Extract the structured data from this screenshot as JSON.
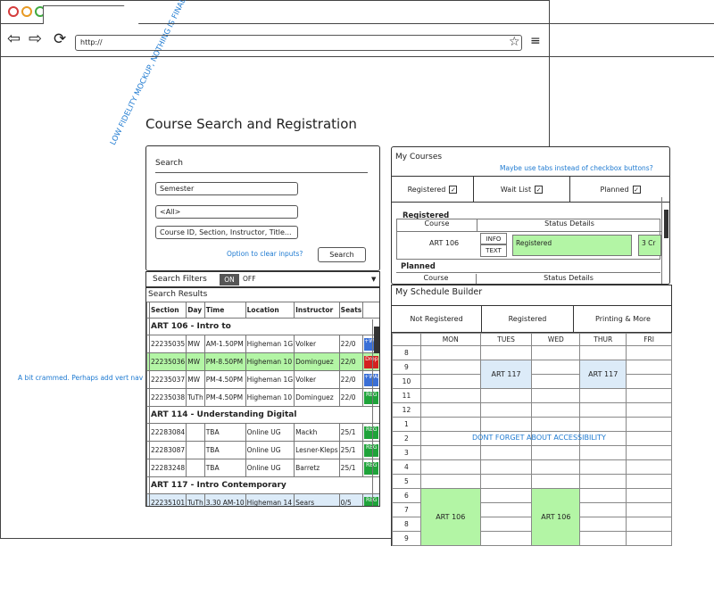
{
  "annotations": {
    "low_fidelity": "LOW FIDELITY MOCKUP, NOTHING IS FINAL!",
    "crammed": "A bit crammed. Perhaps add vert nav",
    "tabs": "Maybe use tabs instead of checkbox buttons?",
    "clear_inputs": "Option to clear inputs?",
    "accessibility": "DONT FORGET ABOUT ACCESSIBILITY"
  },
  "browser": {
    "url": "http://",
    "star_icon": "star-icon",
    "menu_icon": "hamburger-icon"
  },
  "page": {
    "title": "Course Search and Registration"
  },
  "search": {
    "title": "Search",
    "semester": "Semester",
    "all": "<All>",
    "query_placeholder": "Course ID, Section, Instructor, Title...",
    "button": "Search",
    "filters_label": "Search Filters",
    "filters_on": "ON",
    "filters_off": "OFF"
  },
  "results": {
    "title": "Search Results",
    "columns": [
      "Section",
      "Day",
      "Time",
      "Location",
      "Instructor",
      "Seats"
    ],
    "groups": [
      {
        "title": "ART 106 - Intro to",
        "rows": [
          {
            "section": "22235035",
            "day": "MW",
            "time": "AM-1.50PM",
            "location": "Higheman 1G",
            "instructor": "Volker",
            "seats": "22/0",
            "chip": "+WAIT",
            "chip_color": "#3a6fd6",
            "hl": ""
          },
          {
            "section": "22235036",
            "day": "MW",
            "time": "PM-8.50PM",
            "location": "Higheman 10",
            "instructor": "Dominguez",
            "seats": "22/0",
            "chip": "Drop",
            "chip_color": "#d42020",
            "hl": "green"
          },
          {
            "section": "22235037",
            "day": "MW",
            "time": "PM-4.50PM",
            "location": "Higheman 1G",
            "instructor": "Volker",
            "seats": "22/0",
            "chip": "+WAIT",
            "chip_color": "#3a6fd6",
            "hl": ""
          },
          {
            "section": "22235038",
            "day": "TuTh",
            "time": "PM-4.50PM",
            "location": "Higheman 10",
            "instructor": "Dominguez",
            "seats": "22/0",
            "chip": "REG",
            "chip_color": "#1fa33a",
            "hl": ""
          }
        ]
      },
      {
        "title": "ART 114 - Understanding Digital",
        "rows": [
          {
            "section": "22283084",
            "day": "",
            "time": "TBA",
            "location": "Online UG",
            "instructor": "Mackh",
            "seats": "25/1",
            "chip": "REG",
            "chip_color": "#1fa33a",
            "hl": ""
          },
          {
            "section": "22283087",
            "day": "",
            "time": "TBA",
            "location": "Online UG",
            "instructor": "Lesner-Kleps",
            "seats": "25/1",
            "chip": "REG",
            "chip_color": "#1fa33a",
            "hl": ""
          },
          {
            "section": "22283248",
            "day": "",
            "time": "TBA",
            "location": "Online UG",
            "instructor": "Barretz",
            "seats": "25/1",
            "chip": "REG",
            "chip_color": "#1fa33a",
            "hl": ""
          }
        ]
      },
      {
        "title": "ART 117 - Intro Contemporary",
        "rows": [
          {
            "section": "22235101",
            "day": "TuTh",
            "time": "3.30 AM-10",
            "location": "Higheman 14",
            "instructor": "Sears",
            "seats": "0/5",
            "chip": "REG",
            "chip_color": "#1fa33a",
            "hl": "blue"
          }
        ]
      }
    ]
  },
  "my_courses": {
    "title": "My Courses",
    "tabs": [
      {
        "label": "Registered",
        "checked": "✓"
      },
      {
        "label": "Wait List",
        "checked": "✓"
      },
      {
        "label": "Planned",
        "checked": "✓"
      }
    ],
    "registered_header": "Registered",
    "planned_header": "Planned",
    "col_course": "Course",
    "col_status": "Status Details",
    "registered_row": {
      "course": "ART 106",
      "info": "INFO",
      "text": "TEXT",
      "status": "Registered",
      "credits": "3 Cr"
    }
  },
  "schedule": {
    "title": "My Schedule Builder",
    "tabs": [
      "Not Registered",
      "Registered",
      "Printing & More"
    ],
    "days": [
      "MON",
      "TUES",
      "WED",
      "THUR",
      "FRI"
    ],
    "hours": [
      "8",
      "9",
      "10",
      "11",
      "12",
      "1",
      "2",
      "3",
      "4",
      "5",
      "6",
      "7",
      "8",
      "9"
    ],
    "blocks": {
      "tues_9": "ART 117",
      "thur_9": "ART 117",
      "mon_7": "ART 106",
      "wed_7": "ART 106"
    }
  }
}
